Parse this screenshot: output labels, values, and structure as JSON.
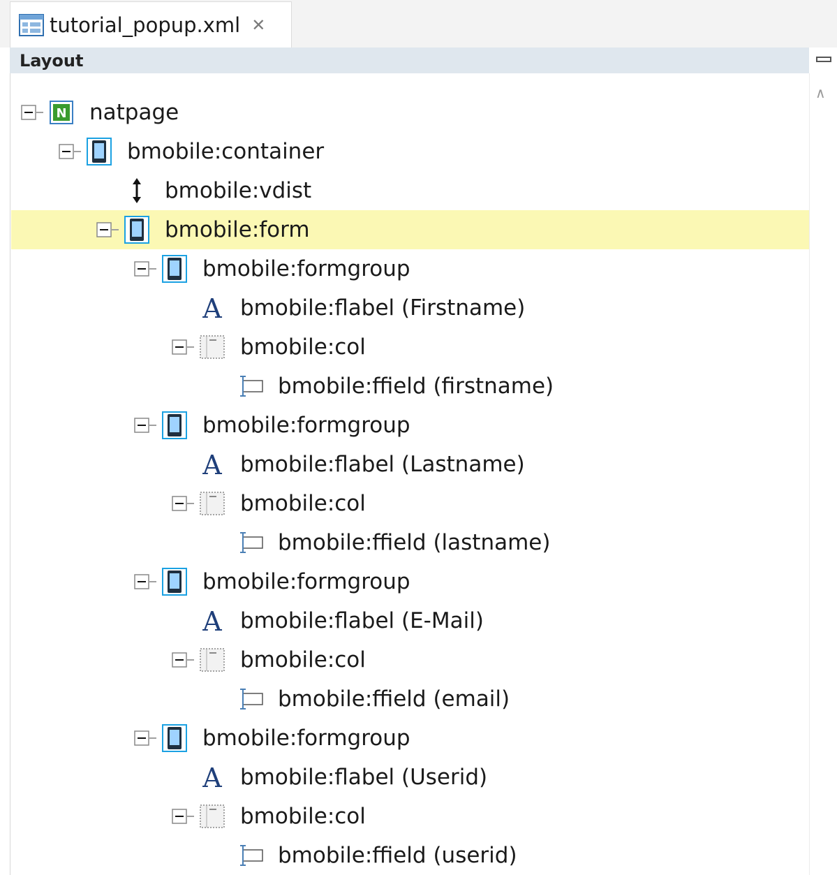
{
  "editor_tab": {
    "title": "tutorial_popup.xml",
    "close_glyph": "✕",
    "icon": "xml-layout-file-icon"
  },
  "panel": {
    "title": "Layout",
    "minimize_icon": "minimize-icon",
    "scroll_up_glyph": "∧"
  },
  "colors": {
    "selected_row": "#fbf8b4",
    "header_bg": "#dfe7ee",
    "container_icon": "#1ba1e2",
    "natpage_icon": "#3a9b2e",
    "label_icon": "#1f3f7a"
  },
  "tree": [
    {
      "level": 0,
      "label": "natpage",
      "icon": "natpage",
      "expanded": true
    },
    {
      "level": 1,
      "label": "bmobile:container",
      "icon": "container",
      "expanded": true
    },
    {
      "level": 2,
      "label": "bmobile:vdist",
      "icon": "vdist"
    },
    {
      "level": 2,
      "label": "bmobile:form",
      "icon": "container",
      "expanded": true,
      "selected": true
    },
    {
      "level": 3,
      "label": "bmobile:formgroup",
      "icon": "container",
      "expanded": true
    },
    {
      "level": 4,
      "label": "bmobile:flabel (Firstname)",
      "icon": "flabel"
    },
    {
      "level": 4,
      "label": "bmobile:col",
      "icon": "col",
      "expanded": true
    },
    {
      "level": 5,
      "label": "bmobile:ffield (firstname)",
      "icon": "ffield"
    },
    {
      "level": 3,
      "label": "bmobile:formgroup",
      "icon": "container",
      "expanded": true
    },
    {
      "level": 4,
      "label": "bmobile:flabel (Lastname)",
      "icon": "flabel"
    },
    {
      "level": 4,
      "label": "bmobile:col",
      "icon": "col",
      "expanded": true
    },
    {
      "level": 5,
      "label": "bmobile:ffield (lastname)",
      "icon": "ffield"
    },
    {
      "level": 3,
      "label": "bmobile:formgroup",
      "icon": "container",
      "expanded": true
    },
    {
      "level": 4,
      "label": "bmobile:flabel (E-Mail)",
      "icon": "flabel"
    },
    {
      "level": 4,
      "label": "bmobile:col",
      "icon": "col",
      "expanded": true
    },
    {
      "level": 5,
      "label": "bmobile:ffield (email)",
      "icon": "ffield"
    },
    {
      "level": 3,
      "label": "bmobile:formgroup",
      "icon": "container",
      "expanded": true
    },
    {
      "level": 4,
      "label": "bmobile:flabel (Userid)",
      "icon": "flabel"
    },
    {
      "level": 4,
      "label": "bmobile:col",
      "icon": "col",
      "expanded": true
    },
    {
      "level": 5,
      "label": "bmobile:ffield (userid)",
      "icon": "ffield"
    }
  ]
}
